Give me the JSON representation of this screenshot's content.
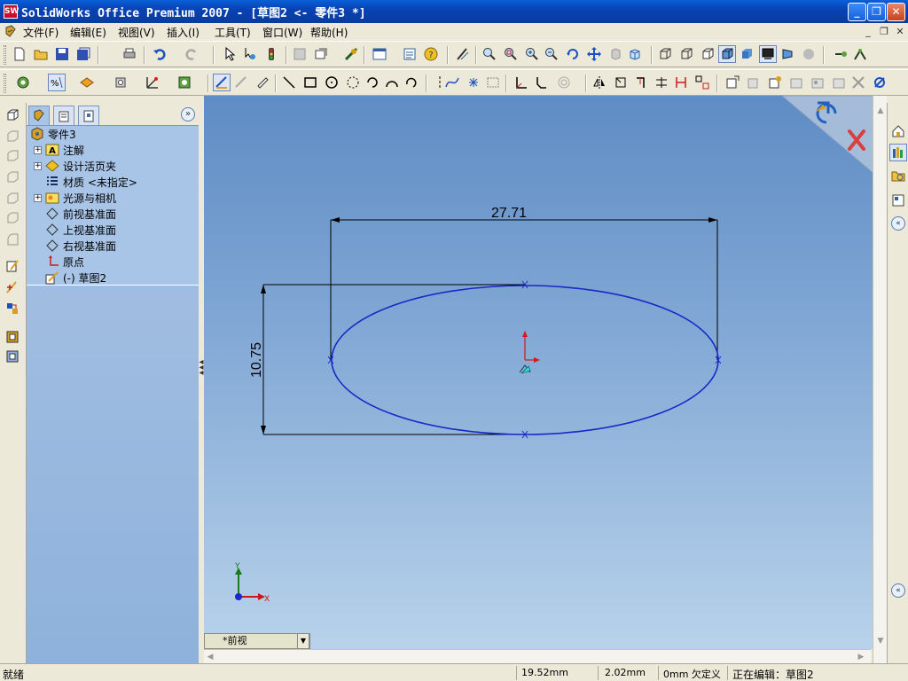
{
  "window": {
    "title": "SolidWorks Office Premium 2007 - [草图2 <- 零件3 *]",
    "logo_text": "SW",
    "minimize_glyph": "_",
    "restore_glyph": "❐",
    "close_glyph": "✕"
  },
  "menu": {
    "items": [
      "文件(F)",
      "编辑(E)",
      "视图(V)",
      "插入(I)",
      "工具(T)",
      "窗口(W)",
      "帮助(H)"
    ],
    "mdi_min": "_",
    "mdi_restore": "❐",
    "mdi_close": "✕"
  },
  "feature_tree": {
    "collapse_glyph": "»",
    "nodes": [
      {
        "label": "零件3",
        "icon": "part-icon"
      },
      {
        "label": "注解",
        "icon": "annotations-icon",
        "expandable": true
      },
      {
        "label": "设计活页夹",
        "icon": "design-binder-icon",
        "expandable": true
      },
      {
        "label": "材质 <未指定>",
        "icon": "material-icon"
      },
      {
        "label": "光源与相机",
        "icon": "lights-cameras-icon",
        "expandable": true
      },
      {
        "label": "前视基准面",
        "icon": "plane-icon"
      },
      {
        "label": "上视基准面",
        "icon": "plane-icon"
      },
      {
        "label": "右视基准面",
        "icon": "plane-icon"
      },
      {
        "label": "原点",
        "icon": "origin-icon"
      },
      {
        "label": "(-)  草图2",
        "icon": "sketch-icon"
      }
    ],
    "expand_glyph": "+"
  },
  "sketch": {
    "dimensions": {
      "horizontal": "27.71",
      "vertical": "10.75"
    },
    "line_color": "#1a28c8",
    "origin_arrow_color": "#d81818",
    "triad": {
      "x": "X",
      "y": "Y"
    }
  },
  "view": {
    "tab_label": "*前视",
    "tab_arrow": "▼"
  },
  "status": {
    "ready": "就绪",
    "x": "19.52mm",
    "y": "2.02mm",
    "z_state": "0mm 欠定义",
    "editing": "正在编辑：草图2"
  },
  "colors": {
    "accent": "#0a5fd8",
    "viewport_top": "#5e8cc4",
    "viewport_bottom": "#b8d2ea"
  }
}
